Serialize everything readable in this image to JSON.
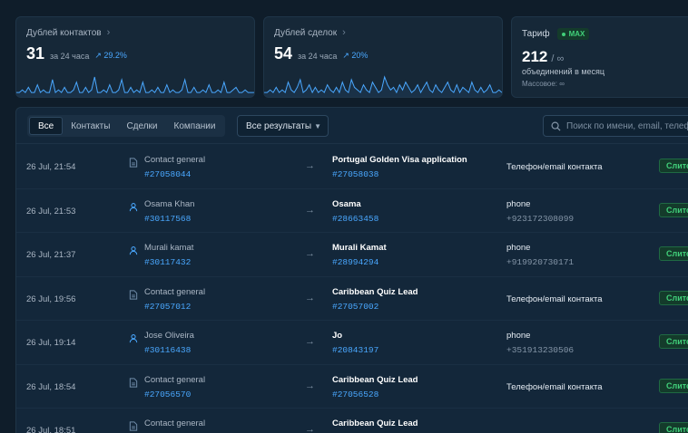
{
  "cards": {
    "contacts": {
      "title": "Дублей контактов",
      "value": "31",
      "period": "за 24 часа",
      "change": "29.2%"
    },
    "deals": {
      "title": "Дублей сделок",
      "value": "54",
      "period": "за 24 часа",
      "change": "20%"
    },
    "tariff": {
      "title": "Тариф",
      "badge": "MAX",
      "value": "212",
      "unit": "/ ∞",
      "line1": "объединений в месяц",
      "line2": "Массовое: ∞"
    }
  },
  "sparklines": {
    "contacts": [
      1,
      1,
      2,
      1,
      3,
      1,
      1,
      4,
      1,
      2,
      1,
      1,
      6,
      1,
      2,
      1,
      3,
      1,
      1,
      2,
      5,
      1,
      1,
      3,
      1,
      2,
      7,
      1,
      1,
      2,
      1,
      4,
      1,
      1,
      2,
      6,
      1,
      1,
      3,
      1,
      2,
      1,
      5,
      1,
      1,
      2,
      1,
      3,
      1,
      1,
      4,
      1,
      2,
      1,
      1,
      2,
      6,
      1,
      1,
      3,
      1,
      1,
      2,
      1,
      4,
      1,
      1,
      2,
      1,
      5,
      1,
      1,
      2,
      3,
      1,
      1,
      2,
      1,
      1,
      1
    ],
    "deals": [
      1,
      1,
      2,
      1,
      3,
      1,
      2,
      1,
      5,
      2,
      1,
      3,
      6,
      1,
      2,
      4,
      1,
      3,
      1,
      2,
      1,
      4,
      2,
      1,
      3,
      1,
      5,
      2,
      1,
      6,
      3,
      2,
      1,
      4,
      2,
      1,
      5,
      3,
      1,
      2,
      7,
      4,
      2,
      3,
      1,
      4,
      2,
      5,
      3,
      1,
      2,
      4,
      1,
      3,
      5,
      2,
      1,
      4,
      2,
      1,
      3,
      5,
      2,
      1,
      4,
      1,
      3,
      2,
      1,
      5,
      2,
      1,
      3,
      1,
      2,
      4,
      1,
      1,
      2,
      1
    ]
  },
  "toolbar": {
    "tabs": [
      "Все",
      "Контакты",
      "Сделки",
      "Компании"
    ],
    "filter": "Все результаты",
    "search_placeholder": "Поиск по имени, email, телефону"
  },
  "colors": {
    "accent": "#4aa8ff",
    "success": "#41d07a",
    "background": "#0f1d2a"
  },
  "rows": [
    {
      "date": "26 Jul, 21:54",
      "src_type": "document-icon",
      "src_name": "Contact general",
      "src_id": "#27058044",
      "tgt_name": "Portugal Golden Visa application",
      "tgt_id": "#27058038",
      "field": "Телефон/email контакта",
      "value": "",
      "status": "Слито"
    },
    {
      "date": "26 Jul, 21:53",
      "src_type": "user-icon",
      "src_name": "Osama Khan",
      "src_id": "#30117568",
      "tgt_name": "Osama",
      "tgt_id": "#28663458",
      "field": "phone",
      "value": "+923172308099",
      "status": "Слито"
    },
    {
      "date": "26 Jul, 21:37",
      "src_type": "user-icon",
      "src_name": "Murali kamat",
      "src_id": "#30117432",
      "tgt_name": "Murali Kamat",
      "tgt_id": "#28994294",
      "field": "phone",
      "value": "+919920730171",
      "status": "Слито"
    },
    {
      "date": "26 Jul, 19:56",
      "src_type": "document-icon",
      "src_name": "Contact general",
      "src_id": "#27057012",
      "tgt_name": "Caribbean Quiz Lead",
      "tgt_id": "#27057002",
      "field": "Телефон/email контакта",
      "value": "",
      "status": "Слито"
    },
    {
      "date": "26 Jul, 19:14",
      "src_type": "user-icon",
      "src_name": "Jose Oliveira",
      "src_id": "#30116438",
      "tgt_name": "Jo",
      "tgt_id": "#20843197",
      "field": "phone",
      "value": "+351913230506",
      "status": "Слито"
    },
    {
      "date": "26 Jul, 18:54",
      "src_type": "document-icon",
      "src_name": "Contact general",
      "src_id": "#27056570",
      "tgt_name": "Caribbean Quiz Lead",
      "tgt_id": "#27056528",
      "field": "Телефон/email контакта",
      "value": "",
      "status": "Слито"
    },
    {
      "date": "26 Jul, 18:51",
      "src_type": "document-icon",
      "src_name": "Contact general",
      "src_id": "",
      "tgt_name": "Caribbean Quiz Lead",
      "tgt_id": "",
      "field": "",
      "value": "",
      "status": "Слито"
    }
  ]
}
